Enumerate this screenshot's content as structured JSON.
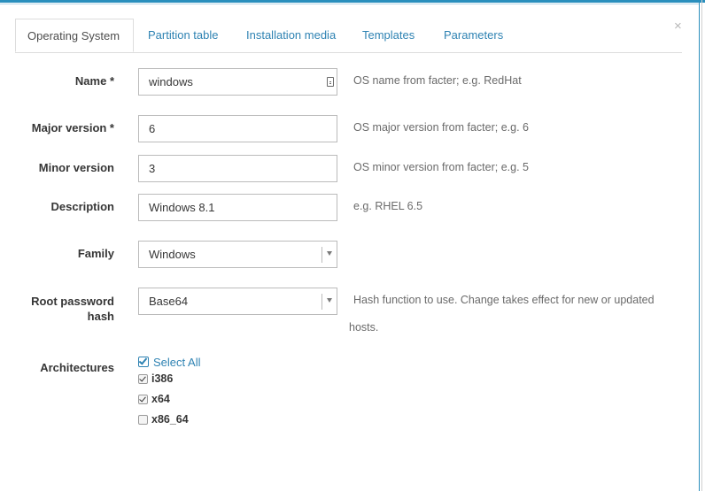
{
  "dialog": {
    "close_glyph": "×"
  },
  "tabs": [
    {
      "label": "Operating System",
      "active": true
    },
    {
      "label": "Partition table"
    },
    {
      "label": "Installation media"
    },
    {
      "label": "Templates"
    },
    {
      "label": "Parameters"
    }
  ],
  "form": {
    "name": {
      "label": "Name *",
      "value": "windows",
      "help": "OS name from facter; e.g. RedHat"
    },
    "major": {
      "label": "Major version *",
      "value": "6",
      "help": "OS major version from facter; e.g. 6"
    },
    "minor": {
      "label": "Minor version",
      "value": "3",
      "help": "OS minor version from facter; e.g. 5"
    },
    "description": {
      "label": "Description",
      "value": "Windows 8.1",
      "help": "e.g. RHEL 6.5"
    },
    "family": {
      "label": "Family",
      "value": "Windows"
    },
    "root_hash": {
      "label_line1": "Root password",
      "label_line2": "hash",
      "value": "Base64",
      "help_line1": "Hash function to use. Change takes effect for new or updated",
      "help_line2": "hosts."
    },
    "architectures": {
      "label": "Architectures",
      "select_all": "Select All",
      "items": [
        {
          "label": "i386",
          "checked": true
        },
        {
          "label": "x64",
          "checked": true
        },
        {
          "label": "x86_64",
          "checked": false
        }
      ]
    }
  },
  "colors": {
    "accent": "#2f83b3",
    "frame": "#2a8fbd",
    "text": "#363636",
    "help": "#6a6a6a"
  },
  "icons": {
    "name_field_addon": "keyboard-icon",
    "select_all": "check-square-icon"
  }
}
